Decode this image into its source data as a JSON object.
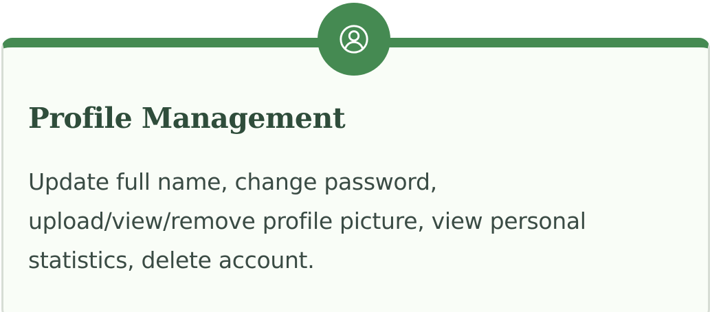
{
  "card": {
    "icon": "user-circle-icon",
    "title": "Profile Management",
    "description": "Update full name, change password, upload/view/remove profile picture, view personal statistics, delete account."
  },
  "colors": {
    "accent": "#458a52",
    "card_background": "#f9fdf7",
    "card_border": "#d7ddd5",
    "title": "#2f4d3b",
    "text": "#3a4b44"
  }
}
